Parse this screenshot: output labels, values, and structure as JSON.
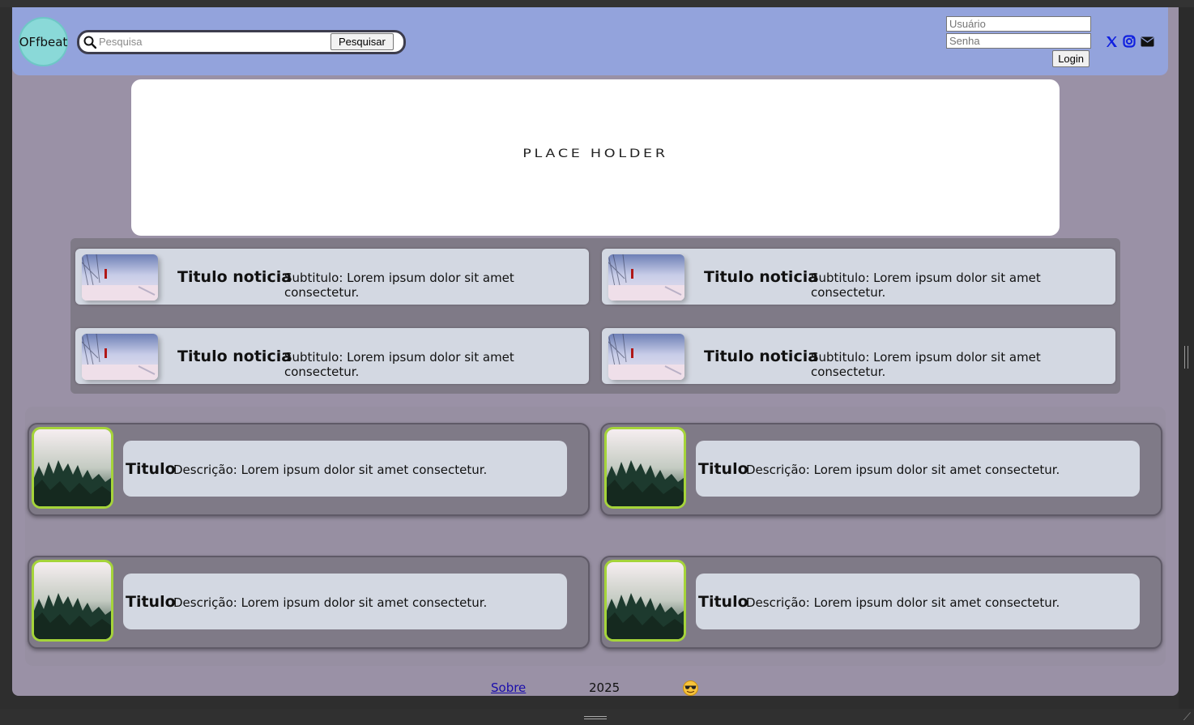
{
  "header": {
    "logo_text": "OFfbeat",
    "search": {
      "placeholder": "Pesquisa",
      "value": "",
      "button_label": "Pesquisar"
    },
    "login": {
      "user_placeholder": "Usuário",
      "password_placeholder": "Senha",
      "button_label": "Login"
    },
    "social_icons": [
      "x-icon",
      "instagram-icon",
      "mail-icon"
    ],
    "accent_color": "#93a3dc"
  },
  "banner": {
    "text": "PLACE HOLDER"
  },
  "news": [
    {
      "title": "Titulo noticia",
      "subtitle": "Subtitulo: Lorem ipsum dolor sit amet consectetur."
    },
    {
      "title": "Titulo noticia",
      "subtitle": "Subtitulo: Lorem ipsum dolor sit amet consectetur."
    },
    {
      "title": "Titulo noticia",
      "subtitle": "Subtitulo: Lorem ipsum dolor sit amet consectetur."
    },
    {
      "title": "Titulo noticia",
      "subtitle": "Subtitulo: Lorem ipsum dolor sit amet consectetur."
    }
  ],
  "articles": [
    {
      "title": "Titulo",
      "description": "Descrição: Lorem ipsum dolor sit amet consectetur."
    },
    {
      "title": "Titulo",
      "description": "Descrição: Lorem ipsum dolor sit amet consectetur."
    },
    {
      "title": "Titulo",
      "description": "Descrição: Lorem ipsum dolor sit amet consectetur."
    },
    {
      "title": "Titulo",
      "description": "Descrição: Lorem ipsum dolor sit amet consectetur."
    }
  ],
  "footer": {
    "link_label": "Sobre",
    "year": "2025",
    "emoji_icon": "sunglasses-emoji-icon"
  }
}
